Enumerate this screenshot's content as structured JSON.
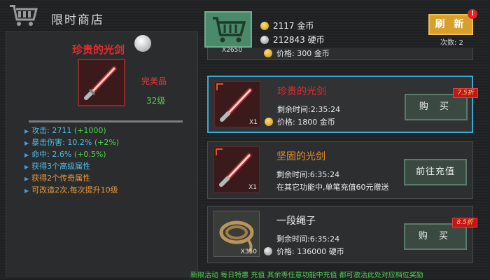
{
  "header": {
    "title": "限时商店"
  },
  "currency": {
    "gold": "2117 金币",
    "silver": "212843 硬币"
  },
  "refresh": {
    "label": "刷 新",
    "badge": "!",
    "count": "次数: 2"
  },
  "detail": {
    "name": "珍贵的光剑",
    "quality": "完美品",
    "level": "32级",
    "stats": [
      {
        "label": "攻击: 2711",
        "bonus": "(+1000)",
        "color": "blue"
      },
      {
        "label": "暴击伤害: 10.2%",
        "bonus": "(+2%)",
        "color": "blue"
      },
      {
        "label": "命中: 2.6%",
        "bonus": "(+0.5%)",
        "color": "blue"
      },
      {
        "label": "获得3个高级属性",
        "bonus": "",
        "color": "blue"
      },
      {
        "label": "获得2个传奇属性",
        "bonus": "",
        "color": "orange"
      },
      {
        "label": "可改造2次,每次提升10级",
        "bonus": "",
        "color": "orange"
      }
    ]
  },
  "shop": {
    "partial_item": {
      "qty": "X2650",
      "price": "价格: 300 金币"
    },
    "items": [
      {
        "name": "珍贵的光剑",
        "name_color": "#e82a2a",
        "time": "剩余时间:2:35:24",
        "price": "价格: 1800 金币",
        "currency": "gold",
        "qty": "X1",
        "button": "购 买",
        "discount": "7.5折",
        "icon": "lightsaber-icon"
      },
      {
        "name": "坚固的光剑",
        "name_color": "#e8902a",
        "time": "剩余时间:6:35:24",
        "price": "在其它功能中,单笔充值60元赠送",
        "currency": "none",
        "qty": "X1",
        "button": "前往充值",
        "discount": "",
        "icon": "lightsaber-icon"
      },
      {
        "name": "一段绳子",
        "name_color": "#f0f0f0",
        "time": "剩余时间:6:35:24",
        "price": "价格: 136000 硬币",
        "currency": "silver",
        "qty": "X350",
        "button": "购 买",
        "discount": "8.5折",
        "icon": "rope-icon"
      }
    ]
  },
  "ticker": "新限活动 每日特惠 充值 其余等任意功能中充值 都可激活此处对应档位奖励"
}
